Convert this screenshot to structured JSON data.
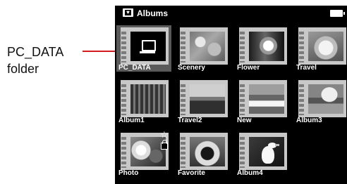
{
  "callout": {
    "label_line1": "PC_DATA",
    "label_line2": "folder"
  },
  "screen": {
    "title": "Albums"
  },
  "albums": [
    {
      "label": "PC_DATA",
      "icon": "computer-folder-icon",
      "selected": true
    },
    {
      "label": "Scenery"
    },
    {
      "label": "Flower"
    },
    {
      "label": "Travel"
    },
    {
      "label": "Album1"
    },
    {
      "label": "Travel2"
    },
    {
      "label": "New"
    },
    {
      "label": "Album3"
    },
    {
      "label": "Photo",
      "icons": [
        "star-icon",
        "lock-icon"
      ]
    },
    {
      "label": "Favorite"
    },
    {
      "label": "Album4"
    }
  ],
  "colors": {
    "accent": "#d31b1b",
    "selection": "#5a5a5a"
  }
}
